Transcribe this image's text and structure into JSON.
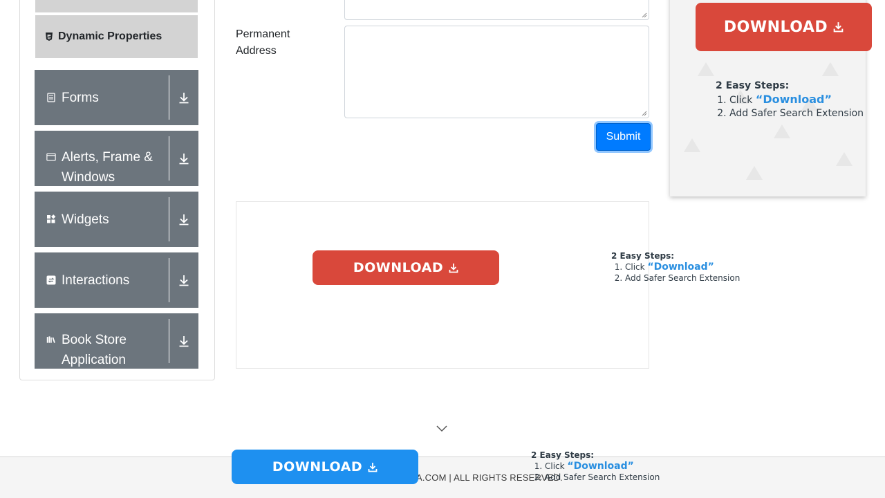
{
  "sidebar": {
    "sub_item": {
      "label": "Dynamic Properties",
      "icon": "html5-icon"
    },
    "groups": [
      {
        "label": "Forms",
        "icon": "form-icon",
        "toggle_icon": "download-arrow-icon"
      },
      {
        "label": "Alerts, Frame & Windows",
        "icon": "window-icon",
        "toggle_icon": "download-arrow-icon"
      },
      {
        "label": "Widgets",
        "icon": "widgets-icon",
        "toggle_icon": "download-arrow-icon"
      },
      {
        "label": "Interactions",
        "icon": "interactions-icon",
        "toggle_icon": "download-arrow-icon"
      },
      {
        "label": "Book Store Application",
        "icon": "books-icon",
        "toggle_icon": "download-arrow-icon"
      }
    ]
  },
  "form": {
    "permanent_address_label": "Permanent Address",
    "permanent_address_value": "",
    "submit_label": "Submit"
  },
  "ads": {
    "download_label": "DOWNLOAD",
    "steps_title": "2 Easy Steps:",
    "step1_prefix": "Click ",
    "step1_highlight": "“Download”",
    "step2": "Add Safer Search Extension"
  },
  "footer": {
    "copyright_visible": "A.COM | ALL RIGHTS RESERVED."
  },
  "colors": {
    "sidebar_group_bg": "#6c757d",
    "sub_item_bg": "#d3d3d3",
    "submit_bg": "#007bff",
    "download_red": "#d9483b",
    "download_blue": "#1e90f0",
    "step_highlight": "#2a8fe0"
  }
}
